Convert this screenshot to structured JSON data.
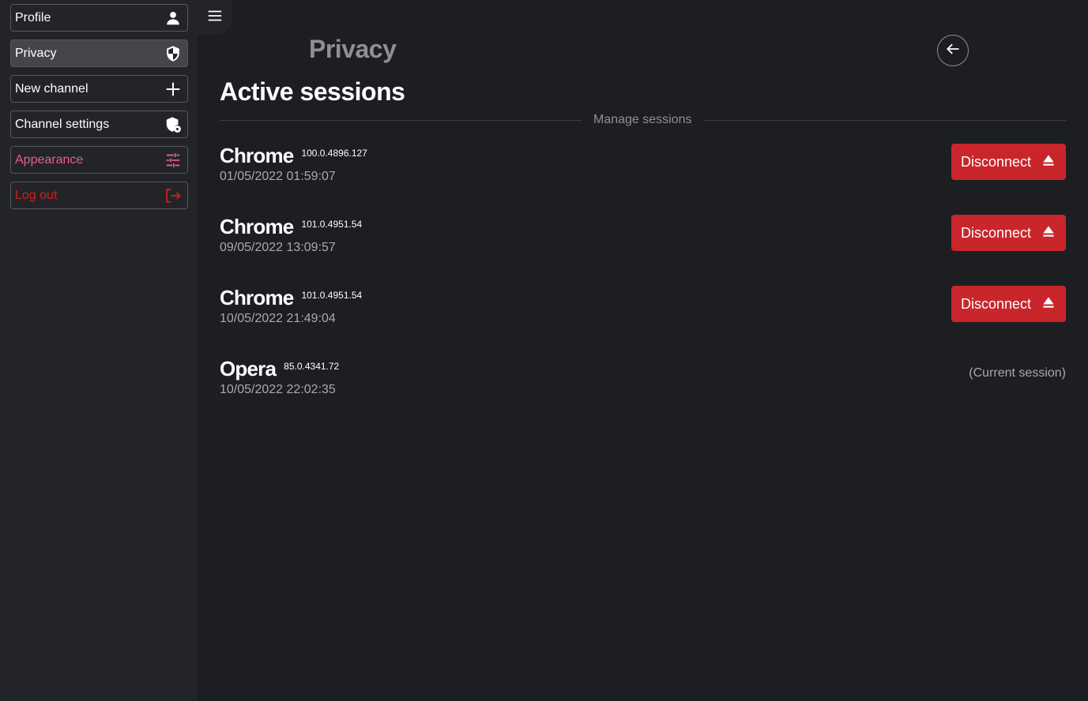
{
  "sidebar": {
    "items": [
      {
        "label": "Profile",
        "icon": "person-icon"
      },
      {
        "label": "Privacy",
        "icon": "shield-icon"
      },
      {
        "label": "New channel",
        "icon": "plus-icon"
      },
      {
        "label": "Channel settings",
        "icon": "shield-gear-icon"
      },
      {
        "label": "Appearance",
        "icon": "sliders-icon"
      },
      {
        "label": "Log out",
        "icon": "logout-icon"
      }
    ],
    "active": "Privacy"
  },
  "header": {
    "title": "Privacy",
    "menu_icon": "hamburger-icon",
    "back_icon": "arrow-left-icon"
  },
  "main": {
    "section_title": "Active sessions",
    "divider_label": "Manage sessions",
    "disconnect_label": "Disconnect",
    "sessions": [
      {
        "browser": "Chrome",
        "version": "100.0.4896.127",
        "date": "01/05/2022 01:59:07",
        "current": false
      },
      {
        "browser": "Chrome",
        "version": "101.0.4951.54",
        "date": "09/05/2022 13:09:57",
        "current": false
      },
      {
        "browser": "Chrome",
        "version": "101.0.4951.54",
        "date": "10/05/2022 21:49:04",
        "current": false
      },
      {
        "browser": "Opera",
        "version": "85.0.4341.72",
        "date": "10/05/2022 22:02:35",
        "current": true
      }
    ],
    "current_session_label": "(Current session)"
  },
  "colors": {
    "background": "#1d1e21",
    "sidebar": "#232428",
    "danger": "#c8262b",
    "appearance": "#e85b9a",
    "logout": "#d01e1e",
    "muted": "#8f9094"
  }
}
